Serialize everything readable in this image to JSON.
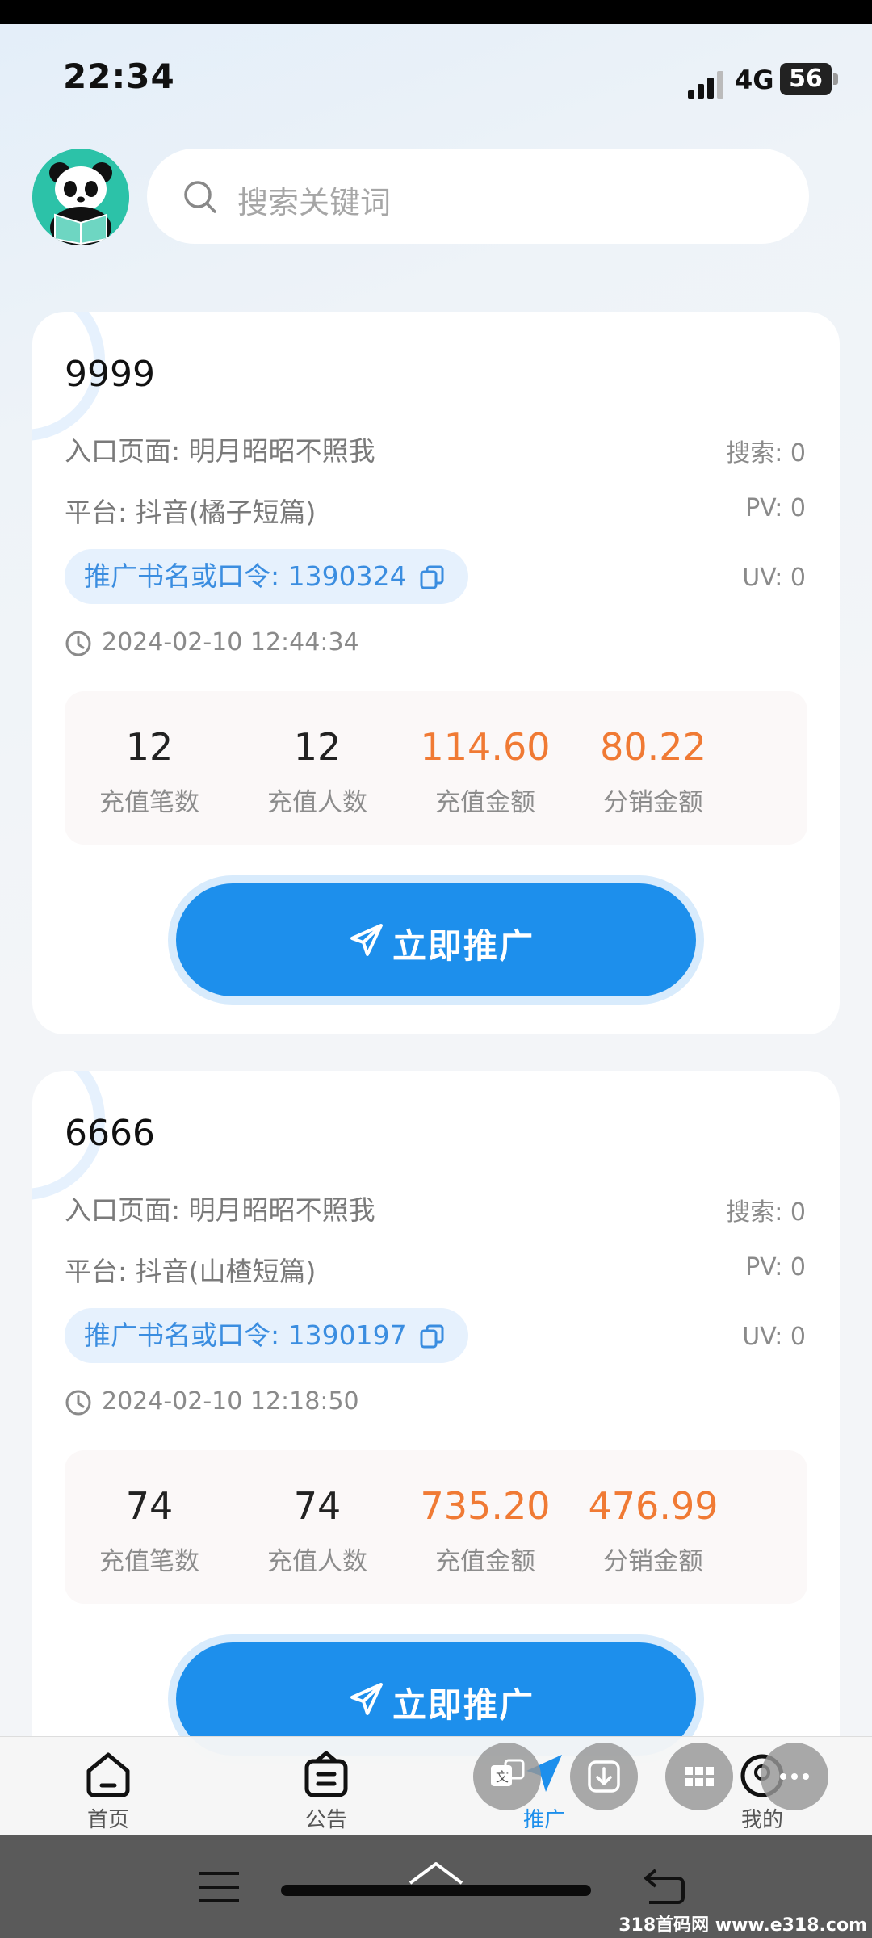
{
  "status_bar": {
    "time": "22:34",
    "network": "4G",
    "battery": "56"
  },
  "search": {
    "placeholder": "搜索关键词"
  },
  "cards": [
    {
      "id": "9999",
      "entry_page": "入口页面: 明月昭昭不照我",
      "platform": "平台: 抖音(橘子短篇)",
      "code": "推广书名或口令: 1390324",
      "search_count": "搜索: 0",
      "pv": "PV: 0",
      "uv": "UV: 0",
      "datetime": "2024-02-10 12:44:34",
      "stats": [
        {
          "value": "12",
          "label": "充值笔数"
        },
        {
          "value": "12",
          "label": "充值人数"
        },
        {
          "value": "114.60",
          "label": "充值金额"
        },
        {
          "value": "80.22",
          "label": "分销金额"
        }
      ],
      "button": "立即推广"
    },
    {
      "id": "6666",
      "entry_page": "入口页面: 明月昭昭不照我",
      "platform": "平台: 抖音(山楂短篇)",
      "code": "推广书名或口令: 1390197",
      "search_count": "搜索: 0",
      "pv": "PV: 0",
      "uv": "UV: 0",
      "datetime": "2024-02-10 12:18:50",
      "stats": [
        {
          "value": "74",
          "label": "充值笔数"
        },
        {
          "value": "74",
          "label": "充值人数"
        },
        {
          "value": "735.20",
          "label": "充值金额"
        },
        {
          "value": "476.99",
          "label": "分销金额"
        }
      ],
      "button": "立即推广"
    }
  ],
  "tabs": [
    {
      "label": "首页",
      "icon": "home-icon"
    },
    {
      "label": "公告",
      "icon": "notice-icon"
    },
    {
      "label": "推广",
      "icon": "promote-icon"
    },
    {
      "label": "我的",
      "icon": "profile-icon"
    }
  ],
  "floating_buttons": [
    "translate-icon",
    "download-icon",
    "apps-grid-icon",
    "more-icon"
  ],
  "watermark": "318首码网 www.e318.com",
  "colors": {
    "accent": "#1d8fec",
    "amount": "#f07a34",
    "pill_bg": "#e6f1fd"
  }
}
